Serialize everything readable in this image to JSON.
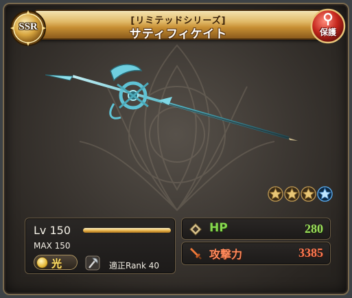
{
  "card": {
    "rarity": "SSR",
    "series": "[リミテッドシリーズ]",
    "name": "サティフィケイト",
    "protect_label": "保護",
    "stars_filled": 3,
    "stars_total": 4
  },
  "level": {
    "label": "Lv 150",
    "progress": 1.0,
    "max_label": "MAX 150"
  },
  "element": {
    "label": "光",
    "icon": "light-element-icon",
    "color": "#e6b938"
  },
  "weapon_type_icon": "axe-icon",
  "rank_label": "適正Rank 40",
  "stats": {
    "hp_label": "HP",
    "hp_value": "280",
    "atk_label": "攻撃力",
    "atk_value": "3385"
  },
  "colors": {
    "header_gold": "#e0b866",
    "hp_green": "#9ee05c",
    "atk_orange": "#ff7a52",
    "element_gold": "#ffe36a"
  }
}
